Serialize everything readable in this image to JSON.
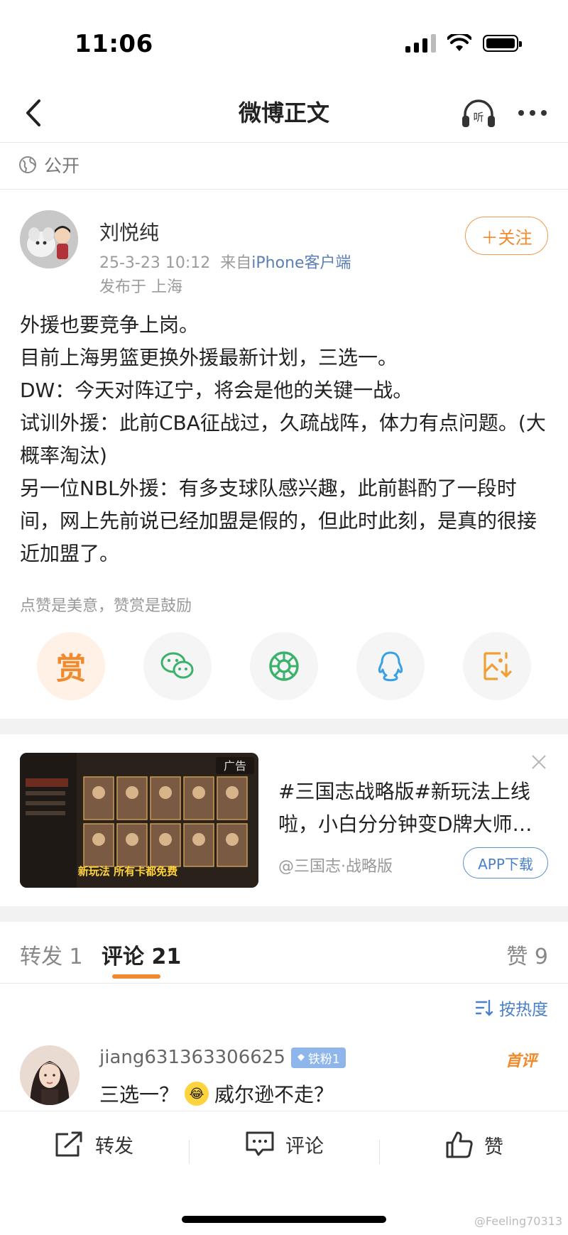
{
  "status_bar": {
    "time": "11:06"
  },
  "nav": {
    "title": "微博正文",
    "listen_label": "听"
  },
  "visibility": {
    "label": "公开"
  },
  "post": {
    "author": "刘悦纯",
    "date": "25-3-23 10:12",
    "source_prefix": "来自",
    "source": "iPhone客户端",
    "location": "发布于 上海",
    "follow_label": "＋关注",
    "paragraphs": [
      "外援也要竞争上岗。",
      "目前上海男篮更换外援最新计划，三选一。",
      "DW：今天对阵辽宁，将会是他的关键一战。",
      "试训外援：此前CBA征战过，久疏战阵，体力有点问题。(大概率淘汰)",
      "另一位NBL外援：有多支球队感兴趣，此前斟酌了一段时间，网上先前说已经加盟是假的，但此时此刻，是真的很接近加盟了。"
    ],
    "tip": "点赞是美意，赞赏是鼓励",
    "share": {
      "reward_label": "赏",
      "items": [
        "reward",
        "wechat",
        "moments",
        "qq",
        "save-image"
      ]
    }
  },
  "ad": {
    "title": "#三国志战略版#新玩法上线啦，小白分分钟变D牌大师…",
    "source": "@三国志·战略版",
    "download_label": "APP下载",
    "badge": "广告",
    "banner": "新玩法 所有卡都免费"
  },
  "tabs": {
    "repost": "转发 1",
    "comment": "评论 21",
    "like": "赞 9"
  },
  "sort": {
    "label": "按热度"
  },
  "comments": [
    {
      "user": "jiang631363306625",
      "badge": "铁粉1",
      "tag": "首评",
      "text_before": "三选一？",
      "text_after": "威尔逊不走？"
    }
  ],
  "bottom_bar": {
    "repost": "转发",
    "comment": "评论",
    "like": "赞"
  },
  "watermark": "@Feeling70313",
  "colors": {
    "accent_orange": "#f08a2c",
    "link_blue": "#4a7fc9",
    "wechat_green": "#3bb26c",
    "qq_blue": "#3aa0e6"
  }
}
